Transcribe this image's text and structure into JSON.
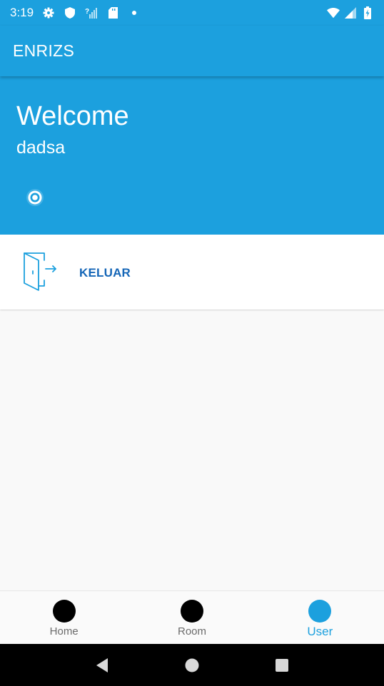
{
  "status_bar": {
    "time": "3:19",
    "left_icons": [
      "gear-icon",
      "shield-icon",
      "signal-unknown-icon",
      "sd-card-icon",
      "dot-icon"
    ],
    "right_icons": [
      "wifi-icon",
      "cell-signal-icon",
      "battery-icon"
    ]
  },
  "app_bar": {
    "title": "ENRIZS"
  },
  "header": {
    "welcome": "Welcome",
    "username": "dadsa"
  },
  "menu": {
    "items": [
      {
        "label": "KELUAR",
        "icon": "logout-door-icon"
      }
    ]
  },
  "bottom_nav": {
    "items": [
      {
        "label": "Home",
        "active": false
      },
      {
        "label": "Room",
        "active": false
      },
      {
        "label": "User",
        "active": true
      }
    ]
  },
  "colors": {
    "primary": "#1ca0de",
    "menu_text": "#1566b7",
    "inactive_nav_text": "#6b6b6b",
    "background": "#f9f9f9"
  }
}
